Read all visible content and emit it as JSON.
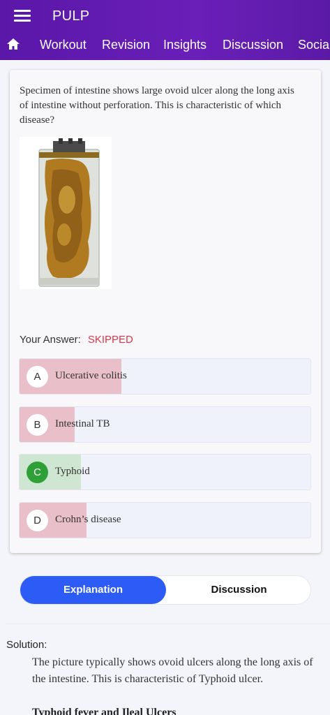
{
  "app": {
    "title": "PULP"
  },
  "nav": {
    "items": [
      {
        "label": "Workout"
      },
      {
        "label": "Revision"
      },
      {
        "label": "Insights"
      },
      {
        "label": "Discussion"
      },
      {
        "label": "Social"
      }
    ]
  },
  "question": {
    "text": "Specimen of intestine shows large ovoid ulcer along the long axis of intestine without perforation. This is characteristic of which disease?",
    "answer_label": "Your Answer:",
    "answer_status": "SKIPPED",
    "options": [
      {
        "letter": "A",
        "text": "Ulcerative colitis",
        "percent": 35,
        "correct": false
      },
      {
        "letter": "B",
        "text": "Intestinal TB",
        "percent": 19,
        "correct": false
      },
      {
        "letter": "C",
        "text": "Typhoid",
        "percent": 21,
        "correct": true
      },
      {
        "letter": "D",
        "text": "Crohn’s disease",
        "percent": 23,
        "correct": false
      }
    ]
  },
  "tabs": {
    "explanation": "Explanation",
    "discussion": "Discussion"
  },
  "solution": {
    "label": "Solution:",
    "text": "The picture typically shows ovoid ulcers along the long axis of the intestine. This is characteristic of Typhoid ulcer.",
    "heading": "Typhoid fever and Ileal Ulcers"
  },
  "colors": {
    "header": "#5a17a8",
    "wrong_fill": "#e9bfca",
    "correct_fill": "#cfe6d3",
    "correct_badge": "#2fa038",
    "active_tab": "#2c5bf6",
    "skipped": "#e2334b"
  },
  "icons": [
    "menu-icon",
    "home-icon"
  ]
}
